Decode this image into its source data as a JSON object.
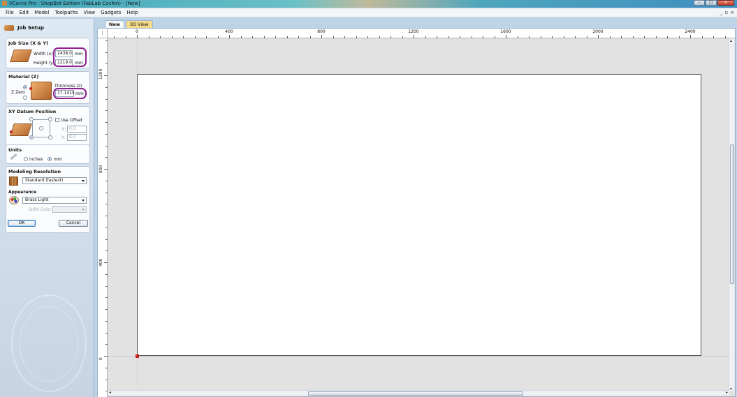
{
  "window": {
    "title": "VCarve Pro - ShopBot Edition (FabLab Cochin) - [New]",
    "buttons": [
      "minimize",
      "maximize",
      "close"
    ]
  },
  "menu": [
    "File",
    "Edit",
    "Model",
    "Toolpaths",
    "View",
    "Gadgets",
    "Help"
  ],
  "mdi_controls": [
    "_",
    "▫",
    "×"
  ],
  "job_setup": {
    "header": "Job Setup",
    "job_size": {
      "title": "Job Size (X & Y)",
      "width_label": "Width (x):",
      "width_value": "2438.0",
      "height_label": "Height (y):",
      "height_value": "1219.0",
      "unit": "mm"
    },
    "material": {
      "title": "Material (Z)",
      "z_zero_label": "Z Zero",
      "thickness_label": "Thickness (z)",
      "thickness_value": "17.1415",
      "unit": "mm"
    },
    "datum": {
      "title": "XY Datum Position",
      "use_offset_label": "Use Offset",
      "x_label": "X:",
      "x_value": "0.0",
      "y_label": "Y:",
      "y_value": "0.0"
    },
    "units": {
      "title": "Units",
      "inches_label": "inches",
      "mm_label": "mm",
      "selected": "mm"
    },
    "resolution": {
      "title": "Modeling Resolution",
      "selected": "Standard (fastest)"
    },
    "appearance": {
      "title": "Appearance",
      "selected": "Brass Light",
      "solid_color_label": "Solid Color:"
    },
    "ok_label": "OK",
    "cancel_label": "Cancel"
  },
  "tabs": [
    {
      "label": "New",
      "active": true
    },
    {
      "label": "3D View",
      "active": false
    }
  ],
  "ruler": {
    "h_labels": [
      "0",
      "400",
      "800",
      "1200",
      "1600",
      "2000",
      "2400"
    ],
    "v_labels": [
      "1200",
      "800",
      "400",
      "0"
    ]
  },
  "colors": {
    "accent_highlight": "#8e1f8e",
    "origin_marker": "#c82020",
    "tab_3d": "#f4da8a"
  }
}
